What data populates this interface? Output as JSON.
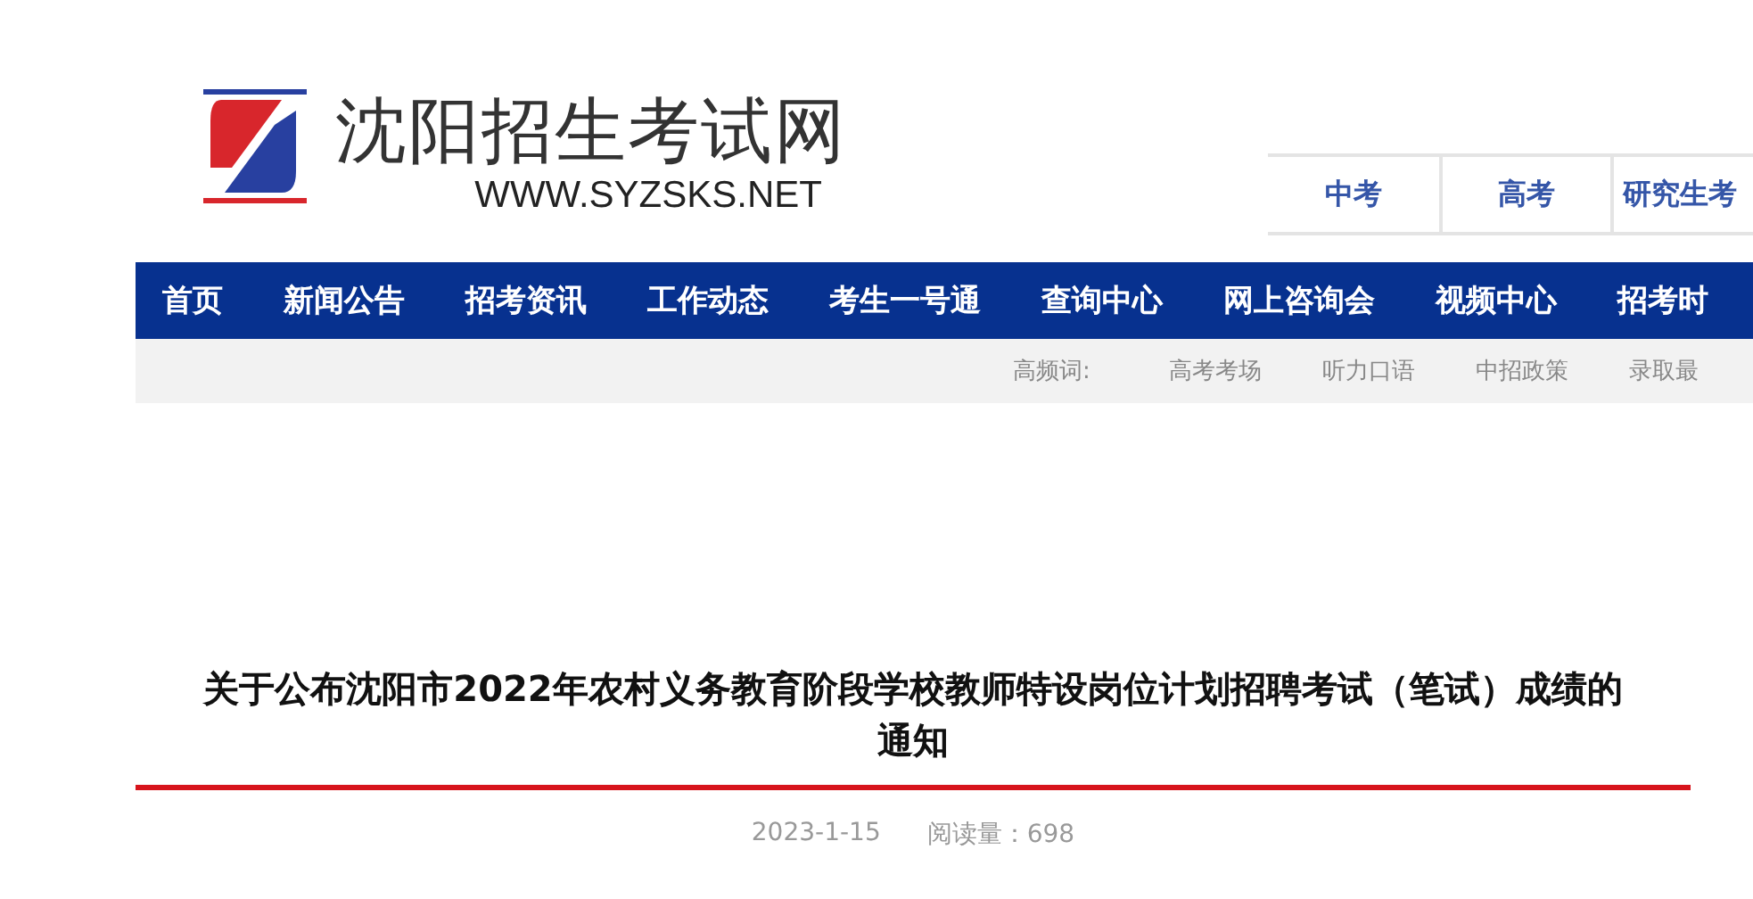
{
  "logo": {
    "name": "沈阳招生考试网",
    "url": "WWW.SYZSKS.NET"
  },
  "top_tabs": [
    "中考",
    "高考",
    "研究生考"
  ],
  "nav": [
    "首页",
    "新闻公告",
    "招考资讯",
    "工作动态",
    "考生一号通",
    "查询中心",
    "网上咨询会",
    "视频中心",
    "招考时"
  ],
  "hot_words": {
    "label": "高频词:",
    "items": [
      "高考考场",
      "听力口语",
      "中招政策",
      "录取最"
    ]
  },
  "article": {
    "title": "关于公布沈阳市2022年农村义务教育阶段学校教师特设岗位计划招聘考试（笔试）成绩的通知",
    "date": "2023-1-15",
    "views": "阅读量：698"
  }
}
